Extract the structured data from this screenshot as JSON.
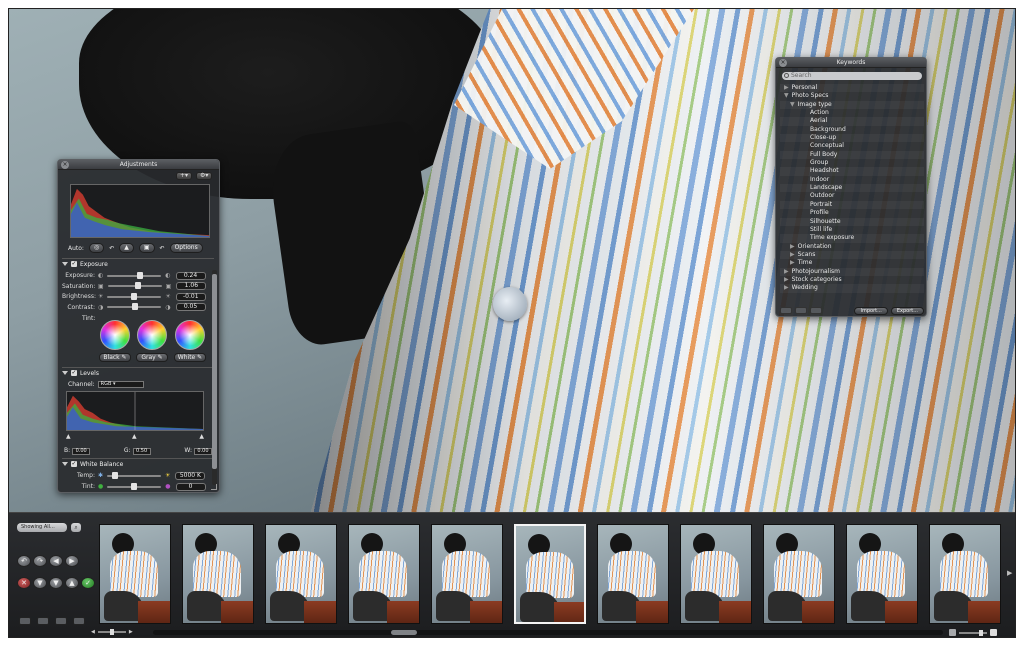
{
  "adjustments": {
    "title": "Adjustments",
    "auto_label": "Auto:",
    "options_label": "Options",
    "exposure": {
      "section_label": "Exposure",
      "rows": [
        {
          "label": "Exposure:",
          "value": "0.24",
          "level": 0.62
        },
        {
          "label": "Saturation:",
          "value": "1.06",
          "level": 0.56
        },
        {
          "label": "Brightness:",
          "value": "-0.01",
          "level": 0.5
        },
        {
          "label": "Contrast:",
          "value": "0.05",
          "level": 0.52
        }
      ],
      "tint_label": "Tint:",
      "tint_buttons": [
        "Black",
        "Gray",
        "White"
      ]
    },
    "levels": {
      "section_label": "Levels",
      "channel_label": "Channel:",
      "channel_value": "RGB",
      "black_label": "B:",
      "black_value": "0.00",
      "gray_label": "G:",
      "gray_value": "0.50",
      "white_label": "W:",
      "white_value": "0.00"
    },
    "white_balance": {
      "section_label": "White Balance",
      "rows": [
        {
          "label": "Temp:",
          "value": "5000 K",
          "level": 0.1
        },
        {
          "label": "Tint:",
          "value": "0",
          "level": 0.5
        }
      ]
    }
  },
  "keywords": {
    "title": "Keywords",
    "search_placeholder": "Search",
    "items": [
      {
        "label": "Personal",
        "indent": 0,
        "arrow": "right"
      },
      {
        "label": "Photo Specs",
        "indent": 0,
        "arrow": "down"
      },
      {
        "label": "Image type",
        "indent": 1,
        "arrow": "down"
      },
      {
        "label": "Action",
        "indent": 2,
        "arrow": ""
      },
      {
        "label": "Aerial",
        "indent": 2,
        "arrow": ""
      },
      {
        "label": "Background",
        "indent": 2,
        "arrow": ""
      },
      {
        "label": "Close-up",
        "indent": 2,
        "arrow": ""
      },
      {
        "label": "Conceptual",
        "indent": 2,
        "arrow": ""
      },
      {
        "label": "Full Body",
        "indent": 2,
        "arrow": ""
      },
      {
        "label": "Group",
        "indent": 2,
        "arrow": ""
      },
      {
        "label": "Headshot",
        "indent": 2,
        "arrow": ""
      },
      {
        "label": "Indoor",
        "indent": 2,
        "arrow": ""
      },
      {
        "label": "Landscape",
        "indent": 2,
        "arrow": ""
      },
      {
        "label": "Outdoor",
        "indent": 2,
        "arrow": ""
      },
      {
        "label": "Portrait",
        "indent": 2,
        "arrow": ""
      },
      {
        "label": "Profile",
        "indent": 2,
        "arrow": ""
      },
      {
        "label": "Silhouette",
        "indent": 2,
        "arrow": ""
      },
      {
        "label": "Still life",
        "indent": 2,
        "arrow": ""
      },
      {
        "label": "Time exposure",
        "indent": 2,
        "arrow": ""
      },
      {
        "label": "Orientation",
        "indent": 1,
        "arrow": "right"
      },
      {
        "label": "Scans",
        "indent": 1,
        "arrow": "right"
      },
      {
        "label": "Time",
        "indent": 1,
        "arrow": "right"
      },
      {
        "label": "Photojournalism",
        "indent": 0,
        "arrow": "right"
      },
      {
        "label": "Stock categories",
        "indent": 0,
        "arrow": "right"
      },
      {
        "label": "Wedding",
        "indent": 0,
        "arrow": "right"
      }
    ],
    "import_label": "Import...",
    "export_label": "Export..."
  },
  "browser": {
    "filter_label": "Showing All...",
    "thumbnail_count": 11,
    "selected_index": 5
  },
  "colors": {
    "hud_background": "#282a2d",
    "accent_selection": "#f4f4f4"
  }
}
